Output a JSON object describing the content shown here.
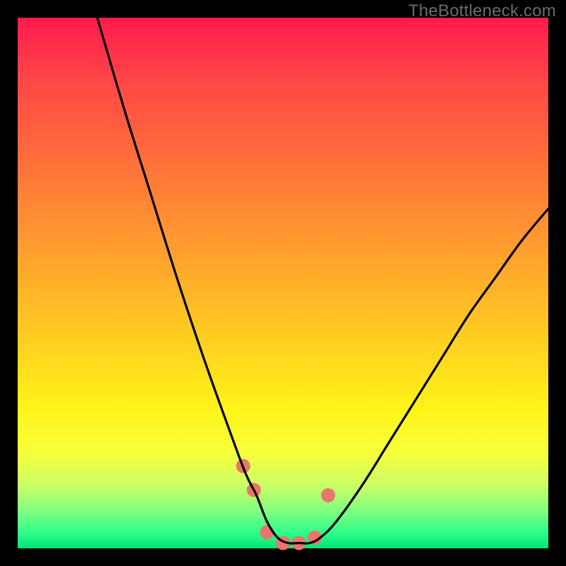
{
  "watermark": "TheBottleneck.com",
  "chart_data": {
    "type": "line",
    "title": "",
    "xlabel": "",
    "ylabel": "",
    "xlim": [
      0,
      100
    ],
    "ylim": [
      0,
      100
    ],
    "series": [
      {
        "name": "bottleneck-curve",
        "x": [
          15,
          20,
          25,
          30,
          35,
          40,
          43,
          45,
          47,
          49,
          51,
          53,
          55,
          57,
          60,
          65,
          70,
          75,
          80,
          85,
          90,
          95,
          100
        ],
        "values": [
          100,
          83,
          67,
          51,
          36,
          22,
          14,
          10,
          5,
          2,
          1,
          1,
          1,
          2,
          5,
          12,
          20,
          28,
          36,
          44,
          51,
          58,
          64
        ]
      }
    ],
    "markers": {
      "name": "highlight-dots",
      "x": [
        42.5,
        44.5,
        47,
        50,
        53,
        56,
        58.5
      ],
      "values": [
        15.5,
        11,
        3,
        1,
        1,
        2,
        10
      ],
      "color": "#e8766b",
      "radius_px": 10
    },
    "background_gradient": {
      "top": "#ff1a4d",
      "mid": "#ffe500",
      "bottom": "#00e676"
    }
  }
}
